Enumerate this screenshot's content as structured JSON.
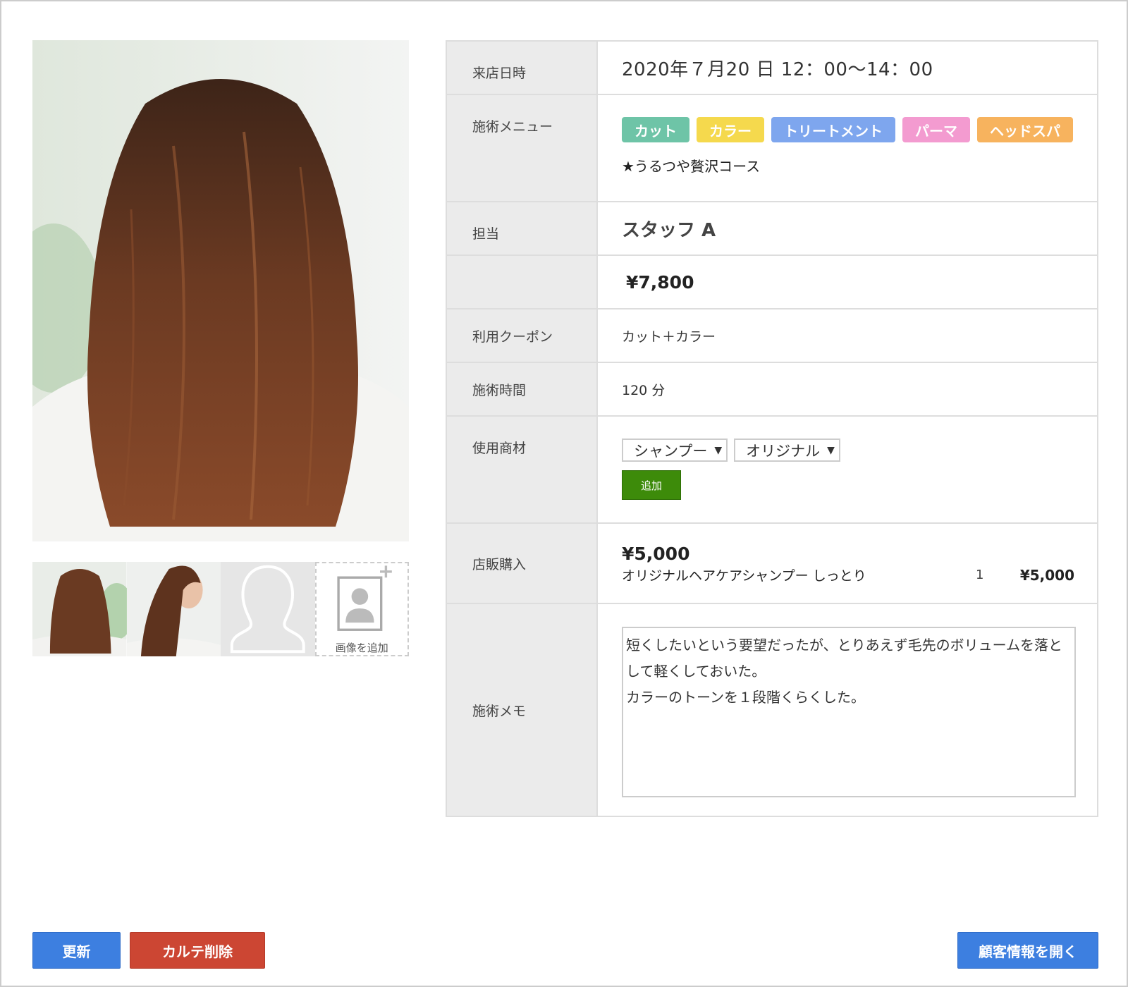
{
  "colors": {
    "accent_blue": "#3d7fe0",
    "danger_red": "#cc4633",
    "add_green": "#3d8b0a"
  },
  "photos": {
    "add_image_label": "画像を追加",
    "add_image_icon": "add-photo-icon",
    "placeholder_icon": "person-silhouette-icon"
  },
  "details": {
    "visit": {
      "label": "来店日時",
      "value": "2020年７月20 日 12：00〜14：00"
    },
    "menu": {
      "label": "施術メニュー",
      "tags": [
        {
          "text": "カット",
          "color": "#6ec4a7"
        },
        {
          "text": "カラー",
          "color": "#f5d94d"
        },
        {
          "text": "トリートメント",
          "color": "#7ea6ee"
        },
        {
          "text": "パーマ",
          "color": "#f39bd0"
        },
        {
          "text": "ヘッドスパ",
          "color": "#f7b35e"
        }
      ],
      "course": "★うるつや贅沢コース"
    },
    "staff": {
      "label": "担当",
      "value": "スタッフ A"
    },
    "price": {
      "label": "",
      "value": "¥7,800"
    },
    "coupon": {
      "label": "利用クーポン",
      "value": "カット＋カラー"
    },
    "duration": {
      "label": "施術時間",
      "value": "120 分"
    },
    "materials": {
      "label": "使用商材",
      "select1": "シャンプー",
      "select2": "オリジナル",
      "add_button": "追加"
    },
    "purchase": {
      "label": "店販購入",
      "total": "¥5,000",
      "item_name": "オリジナルヘアケアシャンプー しっとり",
      "item_qty": "1",
      "item_price": "¥5,000"
    },
    "memo": {
      "label": "施術メモ",
      "text": "短くしたいという要望だったが、とりあえず毛先のボリュームを落として軽くしておいた。\nカラーのトーンを１段階くらくした。"
    }
  },
  "buttons": {
    "update": "更新",
    "delete": "カルテ削除",
    "customer": "顧客情報を開く"
  }
}
